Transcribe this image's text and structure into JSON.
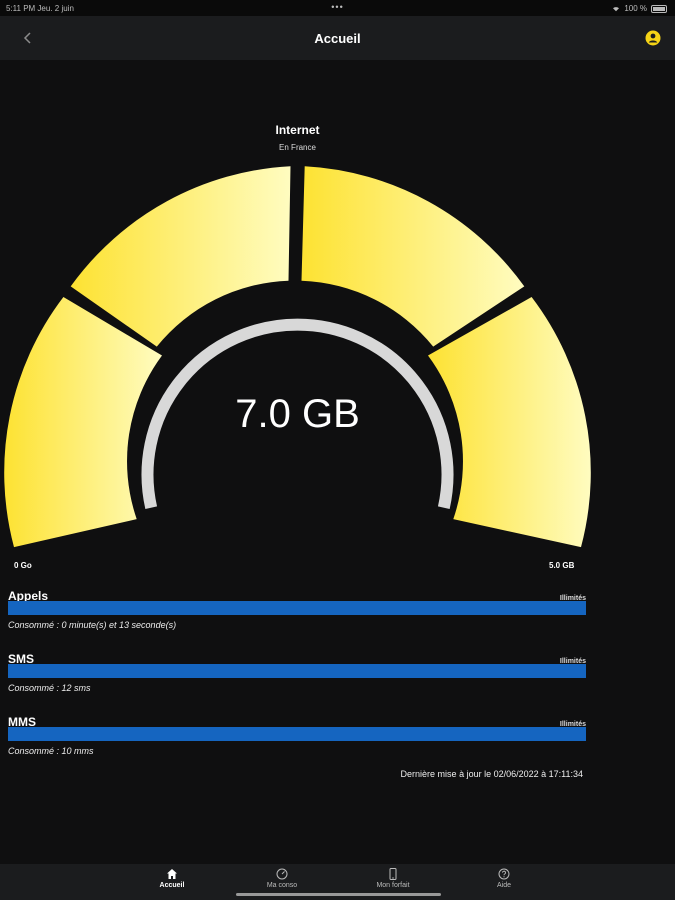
{
  "status_bar": {
    "time_date": "5:11 PM   Jeu. 2 juin",
    "center": "•••",
    "battery": "100 %"
  },
  "header": {
    "title": "Accueil",
    "back_icon": "chevron-left-icon",
    "profile_icon": "user-circle-icon",
    "accent_color": "#f5d316"
  },
  "gauge": {
    "title": "Internet",
    "subtitle": "En France",
    "value_label": "7.0 GB",
    "min_label": "0 Go",
    "max_label": "5.0 GB",
    "colors": {
      "dark_yellow": "#fde232",
      "light_yellow": "#fffcc0",
      "ring": "#d8d8d8"
    }
  },
  "usage": [
    {
      "name": "Appels",
      "limit": "Illimités",
      "consumed": "Consommé : 0 minute(s) et 13 seconde(s)"
    },
    {
      "name": "SMS",
      "limit": "Illimités",
      "consumed": "Consommé : 12 sms"
    },
    {
      "name": "MMS",
      "limit": "Illimités",
      "consumed": "Consommé : 10 mms"
    }
  ],
  "updated": "Dernière mise à jour le 02/06/2022 à 17:11:34",
  "tabs": [
    {
      "label": "Accueil",
      "icon": "home-icon",
      "active": true
    },
    {
      "label": "Ma conso",
      "icon": "gauge-icon",
      "active": false
    },
    {
      "label": "Mon forfait",
      "icon": "phone-icon",
      "active": false
    },
    {
      "label": "Aide",
      "icon": "help-icon",
      "active": false
    }
  ]
}
